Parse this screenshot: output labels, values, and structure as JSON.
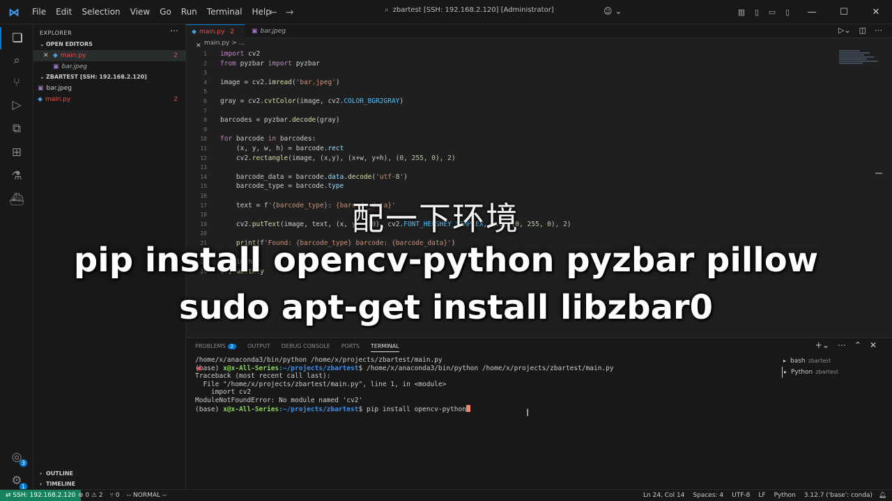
{
  "menu": [
    "File",
    "Edit",
    "Selection",
    "View",
    "Go",
    "Run",
    "Terminal",
    "Help"
  ],
  "window_title": "zbartest [SSH: 192.168.2.120] [Administrator]",
  "explorer": {
    "title": "EXPLORER",
    "open_editors_label": "OPEN EDITORS",
    "open_editors": [
      {
        "name": "main.py",
        "count": "2"
      },
      {
        "name": "bar.jpeg"
      }
    ],
    "folder_label": "ZBARTEST [SSH: 192.168.2.120]",
    "files": [
      {
        "name": "bar.jpeg"
      },
      {
        "name": "main.py",
        "count": "2"
      }
    ],
    "outline_label": "OUTLINE",
    "timeline_label": "TIMELINE"
  },
  "tabs": [
    {
      "name": "main.py",
      "count": "2"
    },
    {
      "name": "bar.jpeg"
    }
  ],
  "breadcrumb": "main.py > ...",
  "code_lines": [
    "import cv2",
    "from pyzbar import pyzbar",
    "",
    "image = cv2.imread('bar.jpeg')",
    "",
    "gray = cv2.cvtColor(image, cv2.COLOR_BGR2GRAY)",
    "",
    "barcodes = pyzbar.decode(gray)",
    "",
    "for barcode in barcodes:",
    "    (x, y, w, h) = barcode.rect",
    "    cv2.rectangle(image, (x,y), (x+w, y+h), (0, 255, 0), 2)",
    "",
    "    barcode_data = barcode.data.decode('utf-8')",
    "    barcode_type = barcode.type",
    "",
    "    text = f'{barcode_type}: {barcode_data}'",
    "",
    "    cv2.putText(image, text, (x, y - 10), cv2.FONT_HERSHEY_SIMPLEX, 0.5, (0, 255, 0), 2)",
    "",
    "    print(f'Found: {barcode_type} barcode: {barcode_data}')",
    "",
    "cv2.imshow",
    "cv2.waitKey"
  ],
  "overlay": {
    "chinese": "配一下环境",
    "line1": "pip install opencv-python pyzbar pillow",
    "line2": "sudo apt-get install libzbar0"
  },
  "panel": {
    "tabs": [
      "PROBLEMS",
      "OUTPUT",
      "DEBUG CONSOLE",
      "PORTS",
      "TERMINAL"
    ],
    "problems_count": "2",
    "active_tab": "TERMINAL"
  },
  "terminal": {
    "line1": "/home/x/anaconda3/bin/python /home/x/projects/zbartest/main.py",
    "prompt_env": "(base)",
    "prompt_user": "x@x-All-Series",
    "prompt_path": ":~/projects/zbartest",
    "cmd1": "$ /home/x/anaconda3/bin/python /home/x/projects/zbartest/main.py",
    "tb1": "Traceback (most recent call last):",
    "tb2": "  File \"/home/x/projects/zbartest/main.py\", line 1, in <module>",
    "tb3": "    import cv2",
    "tb4": "ModuleNotFoundError: No module named 'cv2'",
    "cmd2": "$ pip install opencv-python"
  },
  "terminal_list": [
    {
      "name": "bash",
      "sub": "zbartest"
    },
    {
      "name": "Python",
      "sub": "zbartest"
    }
  ],
  "status": {
    "remote": "SSH: 192.168.2.120",
    "problems": "⊗ 0 ⚠ 2",
    "ports": "⑂ 0",
    "mode": "-- NORMAL --",
    "position": "Ln 24, Col 14",
    "spaces": "Spaces: 4",
    "encoding": "UTF-8",
    "eol": "LF",
    "language": "Python",
    "interpreter": "3.12.7 ('base': conda)"
  },
  "colors": {
    "accent": "#0078d4",
    "remote_bg": "#16825d",
    "error": "#f14c4c"
  }
}
